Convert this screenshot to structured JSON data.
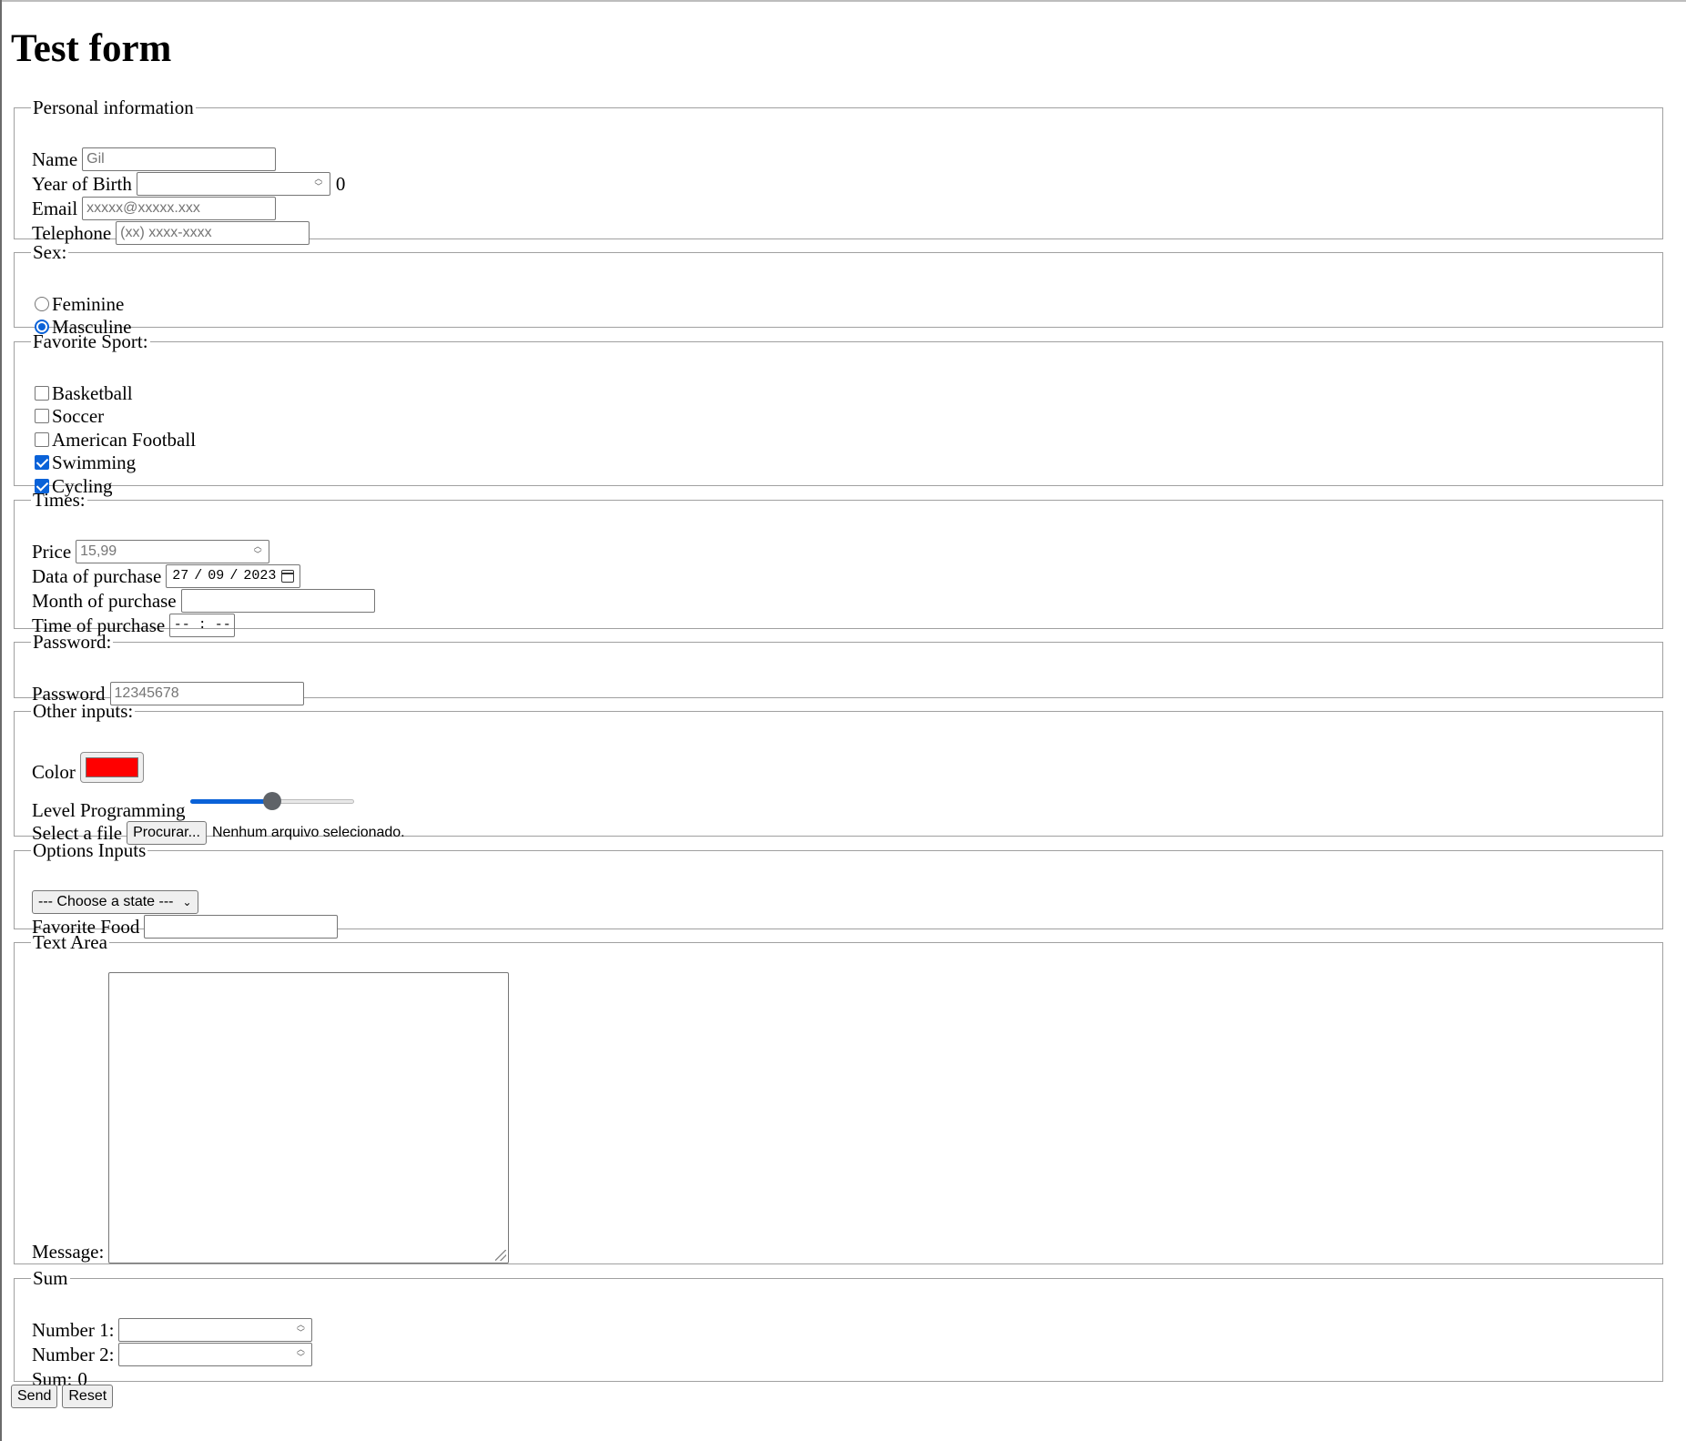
{
  "page_title": "Test form",
  "personal": {
    "legend": "Personal information",
    "name_label": "Name",
    "name_placeholder": "Gil",
    "year_label": "Year of Birth",
    "year_value": "",
    "year_output": "0",
    "email_label": "Email",
    "email_placeholder": "xxxxx@xxxxx.xxx",
    "phone_label": "Telephone",
    "phone_placeholder": "(xx) xxxx-xxxx"
  },
  "sex": {
    "legend": "Sex:",
    "options": [
      {
        "label": "Feminine",
        "checked": false
      },
      {
        "label": "Masculine",
        "checked": true
      }
    ]
  },
  "sport": {
    "legend": "Favorite Sport:",
    "options": [
      {
        "label": "Basketball",
        "checked": false
      },
      {
        "label": "Soccer",
        "checked": false
      },
      {
        "label": "American Football",
        "checked": false
      },
      {
        "label": "Swimming",
        "checked": true
      },
      {
        "label": "Cycling",
        "checked": true
      }
    ]
  },
  "times": {
    "legend": "Times:",
    "price_label": "Price",
    "price_placeholder": "15,99",
    "date_label": "Data of purchase",
    "date_day": "27",
    "date_month": "09",
    "date_year": "2023",
    "month_label": "Month of purchase",
    "month_value": "",
    "time_label": "Time of purchase",
    "time_value": "-- : --"
  },
  "password": {
    "legend": "Password:",
    "label": "Password",
    "placeholder": "12345678"
  },
  "other": {
    "legend": "Other inputs:",
    "color_label": "Color",
    "color_value": "#ff0000",
    "level_label": "Level Programming",
    "level_value": 50,
    "file_label": "Select a file",
    "file_button": "Procurar...",
    "file_status": "Nenhum arquivo selecionado."
  },
  "options": {
    "legend": "Options Inputs",
    "state_select": "--- Choose a state ---",
    "food_label": "Favorite Food",
    "food_value": ""
  },
  "textarea": {
    "legend": "Text Area",
    "message_label": "Message:",
    "message_value": ""
  },
  "sum": {
    "legend": "Sum",
    "n1_label": "Number 1:",
    "n2_label": "Number 2:",
    "sum_label": "Sum:",
    "sum_value": "0"
  },
  "buttons": {
    "send": "Send",
    "reset": "Reset"
  },
  "colors": {
    "accent": "#0a62d8",
    "border": "#767676"
  },
  "icons": {
    "calendar": "calendar-icon",
    "spin": "spinner-arrows-icon",
    "select": "chevron-down-icon"
  }
}
